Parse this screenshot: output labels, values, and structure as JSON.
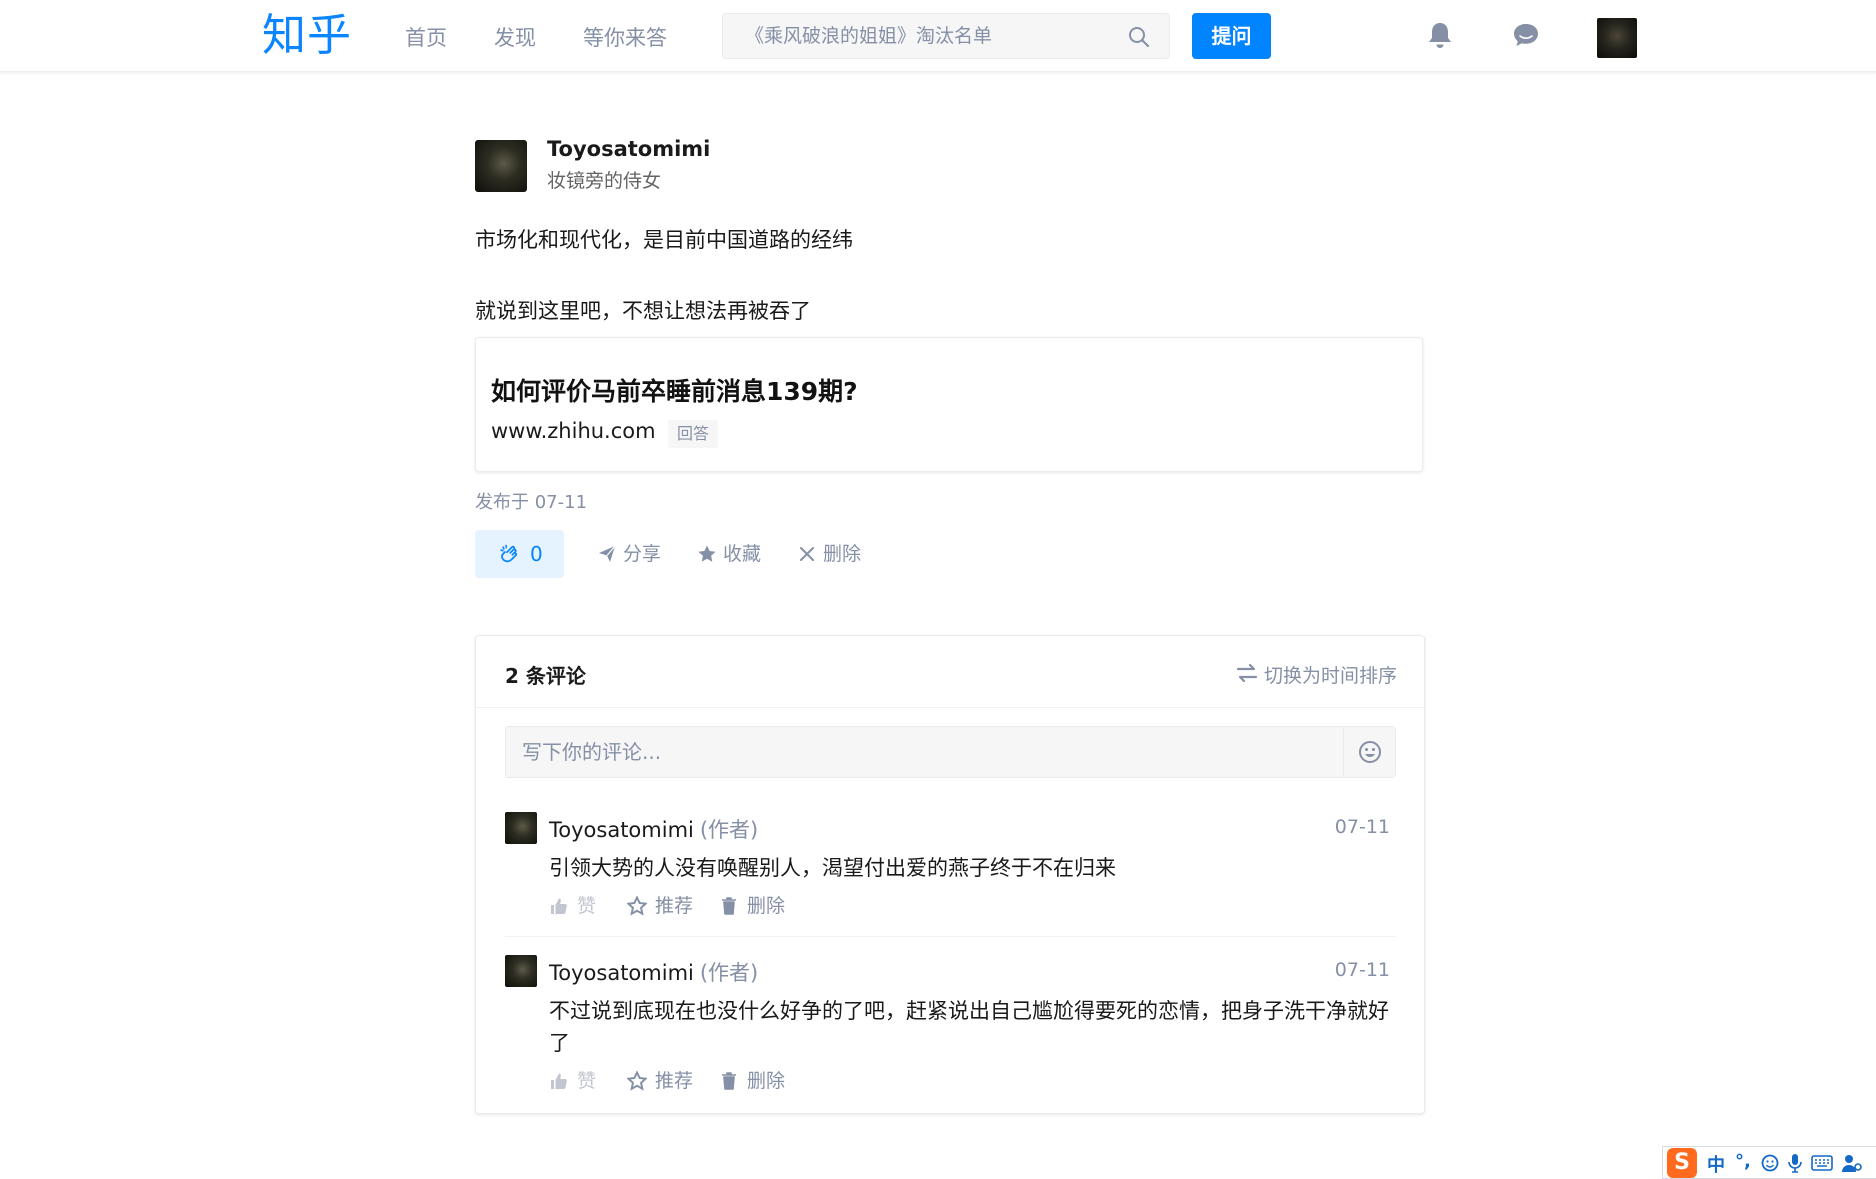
{
  "topbar": {
    "logo": "知乎",
    "nav": [
      "首页",
      "发现",
      "等你来答"
    ],
    "search_placeholder": "《乘风破浪的姐姐》淘汰名单",
    "ask_label": "提问"
  },
  "post": {
    "author_name": "Toyosatomimi",
    "author_bio": "妆镜旁的侍女",
    "lines": [
      "市场化和现代化，是目前中国道路的经纬",
      "就说到这里吧，不想让想法再被吞了"
    ],
    "link_card": {
      "title": "如何评价马前卒睡前消息139期?",
      "url": "www.zhihu.com",
      "tag": "回答"
    },
    "published": "发布于 07-11",
    "actions": {
      "clap_count": "0",
      "share": "分享",
      "collect": "收藏",
      "delete": "删除"
    }
  },
  "comments": {
    "count_label": "2 条评论",
    "sort_label": "切换为时间排序",
    "input_placeholder": "写下你的评论...",
    "items": [
      {
        "author": "Toyosatomimi",
        "role": "(作者)",
        "date": "07-11",
        "text": "引领大势的人没有唤醒别人，渴望付出爱的燕子终于不在归来",
        "like": "赞",
        "recommend": "推荐",
        "delete": "删除"
      },
      {
        "author": "Toyosatomimi",
        "role": "(作者)",
        "date": "07-11",
        "text": "不过说到底现在也没什么好争的了吧，赶紧说出自己尴尬得要死的恋情，把身子洗干净就好了",
        "like": "赞",
        "recommend": "推荐",
        "delete": "删除"
      }
    ]
  },
  "ime": {
    "logo": "S",
    "mode": "中",
    "punct": "°,"
  },
  "colors": {
    "brand": "#0084ff",
    "muted": "#8590a6",
    "text": "#1a1a1a"
  }
}
